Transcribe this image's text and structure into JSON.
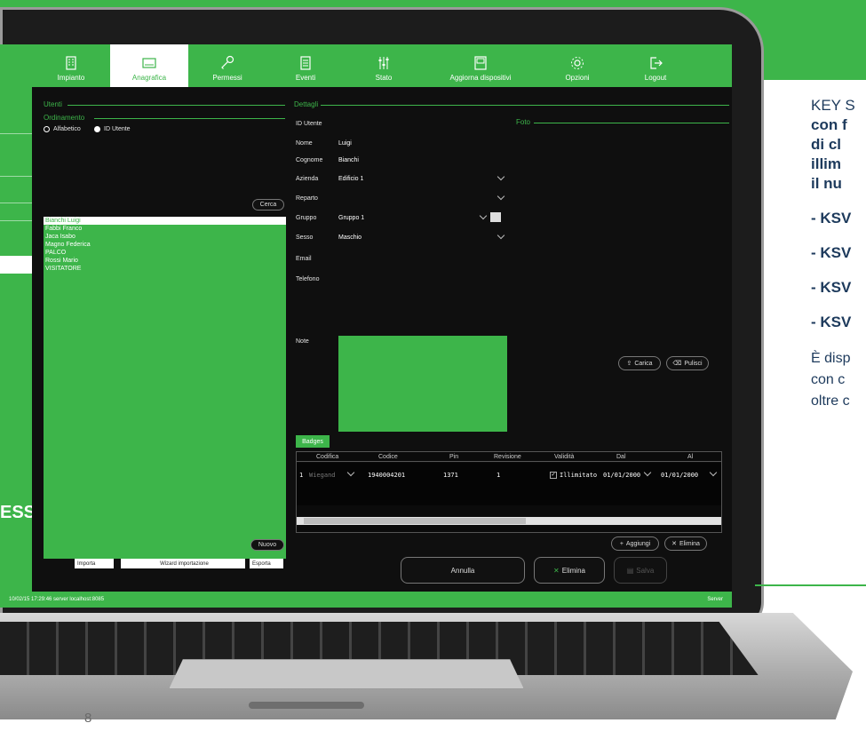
{
  "nav": {
    "items": [
      {
        "label": "Impianto",
        "icon": "building-icon"
      },
      {
        "label": "Anagrafica",
        "icon": "id-card-icon"
      },
      {
        "label": "Permessi",
        "icon": "key-icon"
      },
      {
        "label": "Eventi",
        "icon": "document-icon"
      },
      {
        "label": "Stato",
        "icon": "sliders-icon"
      },
      {
        "label": "Aggiorna dispositivi",
        "icon": "device-icon"
      },
      {
        "label": "Opzioni",
        "icon": "gear-icon"
      },
      {
        "label": "Logout",
        "icon": "logout-icon"
      }
    ]
  },
  "left_panel": {
    "section_title": "Utenti",
    "ordering_title": "Ordinamento",
    "radio_alpha": "Alfabetico",
    "radio_id": "ID Utente",
    "search_button": "Cerca",
    "users": [
      "Bianchi Luigi",
      "Fabbi Franco",
      "Jaca Isabo",
      "Magno Federica",
      "PALCO",
      "Rossi Mario",
      "VISITATORE"
    ],
    "new_button": "Nuovo",
    "import_label": "Importa",
    "wizard_label": "Wizard importazione",
    "export_label": "Esporta"
  },
  "details": {
    "section_title": "Dettagli",
    "photo_title": "Foto",
    "fields": {
      "id_label": "ID Utente",
      "name_label": "Nome",
      "name_value": "Luigi",
      "surname_label": "Cognome",
      "surname_value": "Bianchi",
      "company_label": "Azienda",
      "company_value": "Edificio 1",
      "department_label": "Reparto",
      "group_label": "Gruppo",
      "group_value": "Gruppo 1",
      "sex_label": "Sesso",
      "sex_value": "Maschio",
      "email_label": "Email",
      "phone_label": "Telefono",
      "notes_label": "Note"
    },
    "photo_load": "Carica",
    "photo_clear": "Pulisci"
  },
  "badges": {
    "tab_label": "Badges",
    "columns": [
      "Codifica",
      "Codice",
      "Pin",
      "Revisione",
      "Validità",
      "Dal",
      "Al"
    ],
    "row": {
      "index": "1",
      "codifica": "Wiegand",
      "codice": "1940004201",
      "pin": "1371",
      "revisione": "1",
      "validita": "Illimitato",
      "dal": "01/01/2000",
      "al": "01/01/2000"
    },
    "add_button": "Aggiungi",
    "delete_button": "Elimina"
  },
  "actions": {
    "cancel": "Annulla",
    "delete": "Elimina",
    "save": "Salva"
  },
  "status_bar": {
    "left": "10/02/15 17:29:46 server localhost:8085",
    "right": "Server"
  },
  "brand": {
    "ess": "ESS"
  },
  "right_text": {
    "line1": "KEY S",
    "line2": "con f",
    "line3": "di cl",
    "line4": "illim",
    "line5": "il nu",
    "bullets": [
      "- KSV",
      "- KSV",
      "- KSV",
      "- KSV"
    ],
    "tail1": "È disp",
    "tail2": "con c",
    "tail3": "oltre c"
  },
  "page_number": "8",
  "colors": {
    "accent": "#3db54a",
    "dark_bg": "#0f0f0f",
    "text_blue": "#1d3a5c"
  }
}
